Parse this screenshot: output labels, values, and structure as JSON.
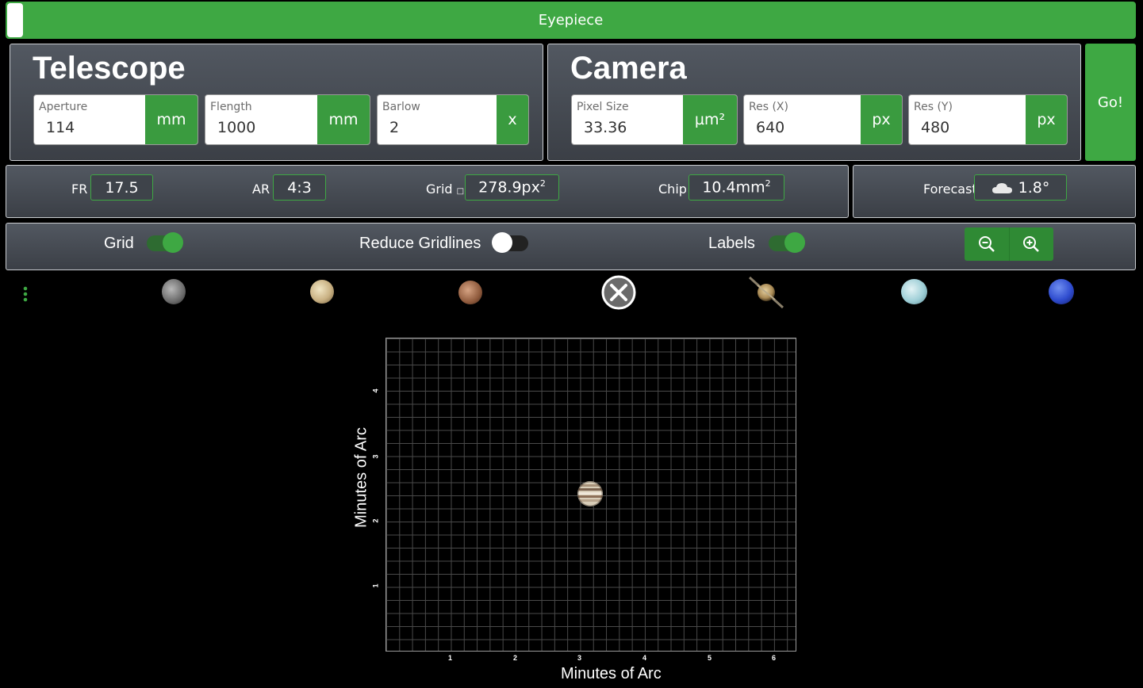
{
  "topbar": {
    "title": "Eyepiece"
  },
  "telescope": {
    "title": "Telescope",
    "fields": [
      {
        "label": "Aperture",
        "value": "114",
        "unit": "mm"
      },
      {
        "label": "Flength",
        "value": "1000",
        "unit": "mm"
      },
      {
        "label": "Barlow",
        "value": "2",
        "unit": "x"
      }
    ]
  },
  "camera": {
    "title": "Camera",
    "fields": [
      {
        "label": "Pixel Size",
        "value": "33.36",
        "unit": "µm²"
      },
      {
        "label": "Res (X)",
        "value": "640",
        "unit": "px"
      },
      {
        "label": "Res (Y)",
        "value": "480",
        "unit": "px"
      }
    ]
  },
  "go_label": "Go!",
  "stats": {
    "fr": {
      "label": "FR",
      "value": "17.5"
    },
    "ar": {
      "label": "AR",
      "value": "4:3"
    },
    "grid": {
      "label": "Grid",
      "value": "278.9px",
      "sup": "2"
    },
    "chip": {
      "label": "Chip",
      "value": "10.4mm",
      "sup": "2"
    },
    "forecast": {
      "label": "Forecast",
      "value": "1.8°",
      "icon": "cloud-icon"
    }
  },
  "toggles": {
    "grid": {
      "label": "Grid",
      "on": true
    },
    "reduce": {
      "label": "Reduce Gridlines",
      "on": false
    },
    "labels": {
      "label": "Labels",
      "on": true
    }
  },
  "planets": [
    "Mercury",
    "Venus",
    "Mars",
    "Jupiter",
    "Saturn",
    "Uranus",
    "Neptune"
  ],
  "plot": {
    "xlabel": "Minutes of Arc",
    "ylabel": "Minutes of Arc",
    "xticks": [
      "1",
      "2",
      "3",
      "4",
      "5",
      "6"
    ],
    "yticks": [
      "1",
      "2",
      "3",
      "4"
    ]
  }
}
